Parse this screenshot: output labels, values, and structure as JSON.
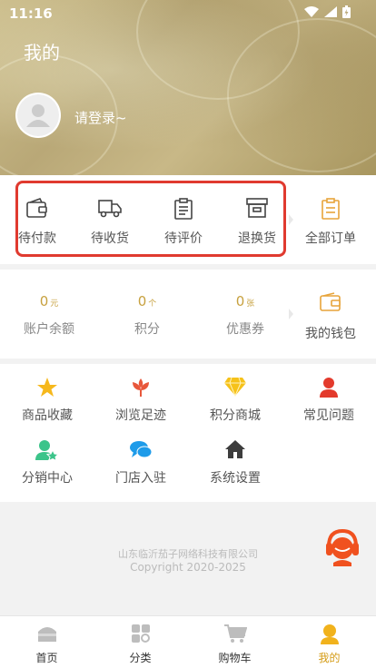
{
  "status_bar": {
    "time": "11:16"
  },
  "header": {
    "title": "我的",
    "login_prompt": "请登录~"
  },
  "orders": {
    "items": [
      {
        "label": "待付款",
        "icon": "wallet-icon"
      },
      {
        "label": "待收货",
        "icon": "truck-icon"
      },
      {
        "label": "待评价",
        "icon": "clipboard-icon"
      },
      {
        "label": "退换货",
        "icon": "archive-box-icon"
      }
    ],
    "all_orders_label": "全部订单"
  },
  "wallet": {
    "balance": {
      "value": "0",
      "unit": "元",
      "label": "账户余额"
    },
    "points": {
      "value": "0",
      "unit": "个",
      "label": "积分"
    },
    "coupons": {
      "value": "0",
      "unit": "张",
      "label": "优惠券"
    },
    "my_wallet_label": "我的钱包"
  },
  "tools": [
    {
      "label": "商品收藏",
      "icon": "star-icon"
    },
    {
      "label": "浏览足迹",
      "icon": "flower-icon"
    },
    {
      "label": "积分商城",
      "icon": "diamond-icon"
    },
    {
      "label": "常见问题",
      "icon": "person-icon"
    },
    {
      "label": "分销中心",
      "icon": "user-star-icon"
    },
    {
      "label": "门店入驻",
      "icon": "chat-bubbles-icon"
    },
    {
      "label": "系统设置",
      "icon": "home-icon"
    }
  ],
  "footer": {
    "company": "山东临沂茄子网络科技有限公司",
    "copyright": "Copyright 2020-2025"
  },
  "tabbar": [
    {
      "label": "首页",
      "icon": "home-tab-icon"
    },
    {
      "label": "分类",
      "icon": "category-icon"
    },
    {
      "label": "购物车",
      "icon": "cart-icon"
    },
    {
      "label": "我的",
      "icon": "profile-icon",
      "active": true
    }
  ],
  "colors": {
    "accent": "#d49b14",
    "highlight_border": "#e03a2f",
    "value_gold": "#c7a13f"
  }
}
